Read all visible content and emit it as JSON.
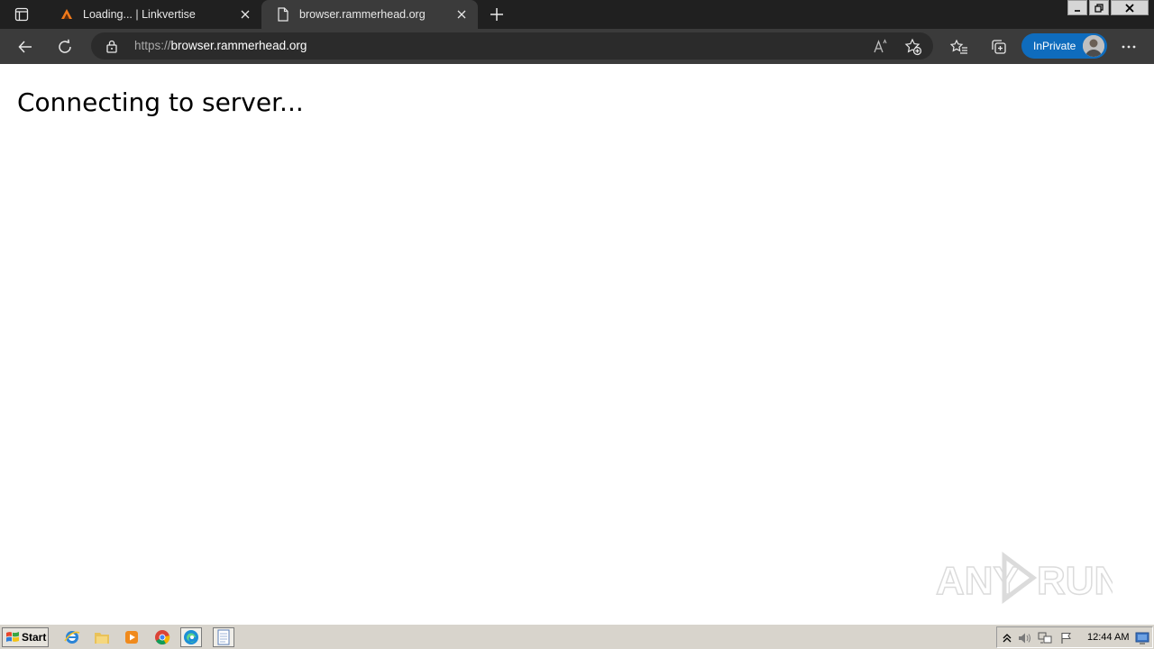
{
  "browser": {
    "tabs": [
      {
        "title": "Loading... | Linkvertise",
        "favicon": "linkvertise-icon",
        "active": false
      },
      {
        "title": "browser.rammerhead.org",
        "favicon": "page-icon",
        "active": true
      }
    ],
    "address": {
      "scheme": "https://",
      "host": "browser.rammerhead.org"
    },
    "inprivate_label": "InPrivate",
    "accent": "#0f6cbd"
  },
  "page": {
    "message": "Connecting to server..."
  },
  "watermark": {
    "text": "ANY RUN"
  },
  "taskbar": {
    "start_label": "Start",
    "apps": [
      "ie-icon",
      "explorer-icon",
      "media-player-icon",
      "chrome-icon",
      "edge-icon",
      "notepad-icon"
    ],
    "clock": "12:44 AM"
  }
}
